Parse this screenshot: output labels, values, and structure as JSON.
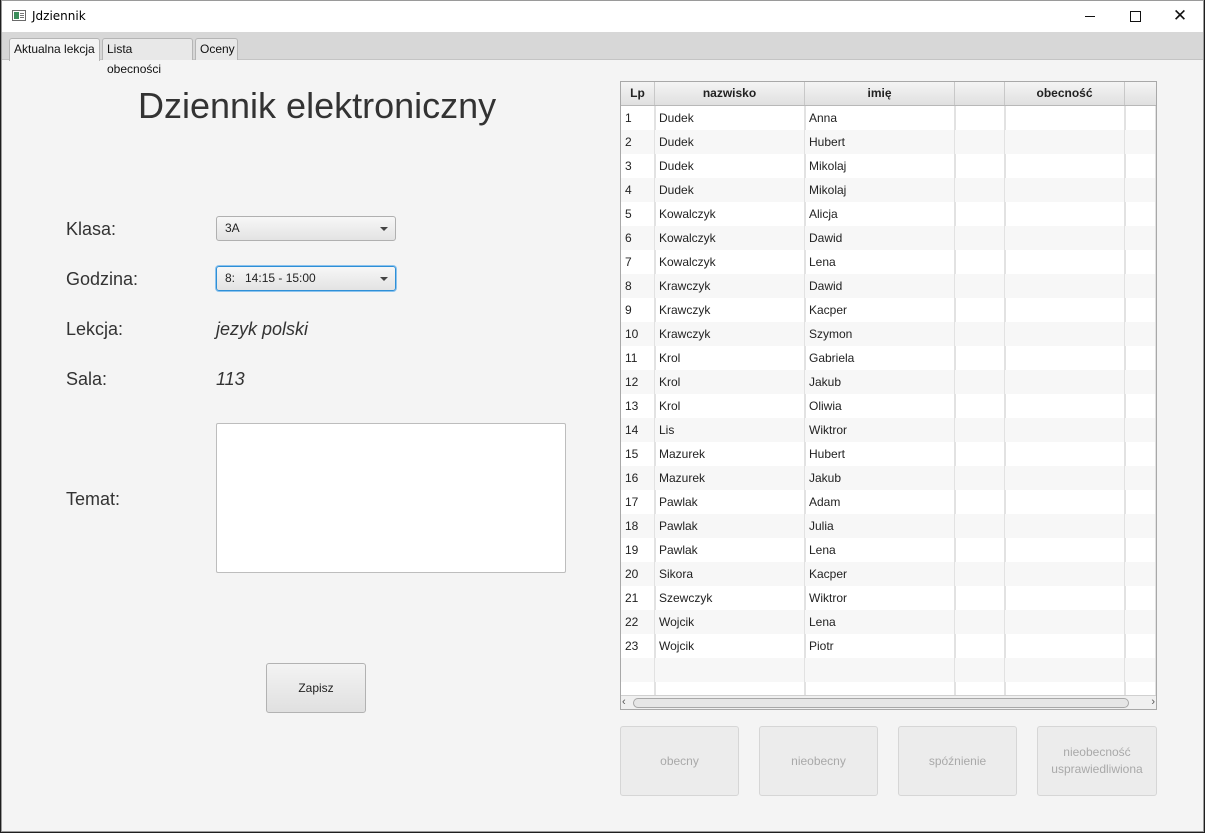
{
  "window": {
    "title": "Jdziennik"
  },
  "tabs": [
    {
      "label": "Aktualna lekcja"
    },
    {
      "label": "Lista obecności"
    },
    {
      "label": "Oceny"
    }
  ],
  "main": {
    "heading": "Dziennik elektroniczny",
    "klasa_label": "Klasa:",
    "klasa_value": "3A",
    "godzina_label": "Godzina:",
    "godzina_value": "8:   14:15 - 15:00",
    "lekcja_label": "Lekcja:",
    "lekcja_value": "jezyk polski",
    "sala_label": "Sala:",
    "sala_value": "113",
    "temat_label": "Temat:",
    "temat_value": "",
    "save_label": "Zapisz"
  },
  "table": {
    "columns": [
      "Lp",
      "nazwisko",
      "imię",
      "",
      "obecność"
    ],
    "rows": [
      [
        "1",
        "Dudek",
        "Anna"
      ],
      [
        "2",
        "Dudek",
        "Hubert"
      ],
      [
        "3",
        "Dudek",
        "Mikolaj"
      ],
      [
        "4",
        "Dudek",
        "Mikolaj"
      ],
      [
        "5",
        "Kowalczyk",
        "Alicja"
      ],
      [
        "6",
        "Kowalczyk",
        "Dawid"
      ],
      [
        "7",
        "Kowalczyk",
        "Lena"
      ],
      [
        "8",
        "Krawczyk",
        "Dawid"
      ],
      [
        "9",
        "Krawczyk",
        "Kacper"
      ],
      [
        "10",
        "Krawczyk",
        "Szymon"
      ],
      [
        "11",
        "Krol",
        "Gabriela"
      ],
      [
        "12",
        "Krol",
        "Jakub"
      ],
      [
        "13",
        "Krol",
        "Oliwia"
      ],
      [
        "14",
        "Lis",
        "Wiktror"
      ],
      [
        "15",
        "Mazurek",
        "Hubert"
      ],
      [
        "16",
        "Mazurek",
        "Jakub"
      ],
      [
        "17",
        "Pawlak",
        "Adam"
      ],
      [
        "18",
        "Pawlak",
        "Julia"
      ],
      [
        "19",
        "Pawlak",
        "Lena"
      ],
      [
        "20",
        "Sikora",
        "Kacper"
      ],
      [
        "21",
        "Szewczyk",
        "Wiktror"
      ],
      [
        "22",
        "Wojcik",
        "Lena"
      ],
      [
        "23",
        "Wojcik",
        "Piotr"
      ]
    ]
  },
  "attendance_buttons": {
    "present": "obecny",
    "absent": "nieobecny",
    "late": "spóźnienie",
    "excused_line1": "nieobecność",
    "excused_line2": "usprawiedliwiona"
  },
  "icons": {
    "minimize": "minimize-icon",
    "maximize": "maximize-icon",
    "close": "close-icon",
    "dropdown": "chevron-down-icon"
  },
  "colors": {
    "focus_border": "#2e8fd6",
    "window_bg": "#f4f4f4",
    "disabled_text": "#a9a9a9"
  }
}
